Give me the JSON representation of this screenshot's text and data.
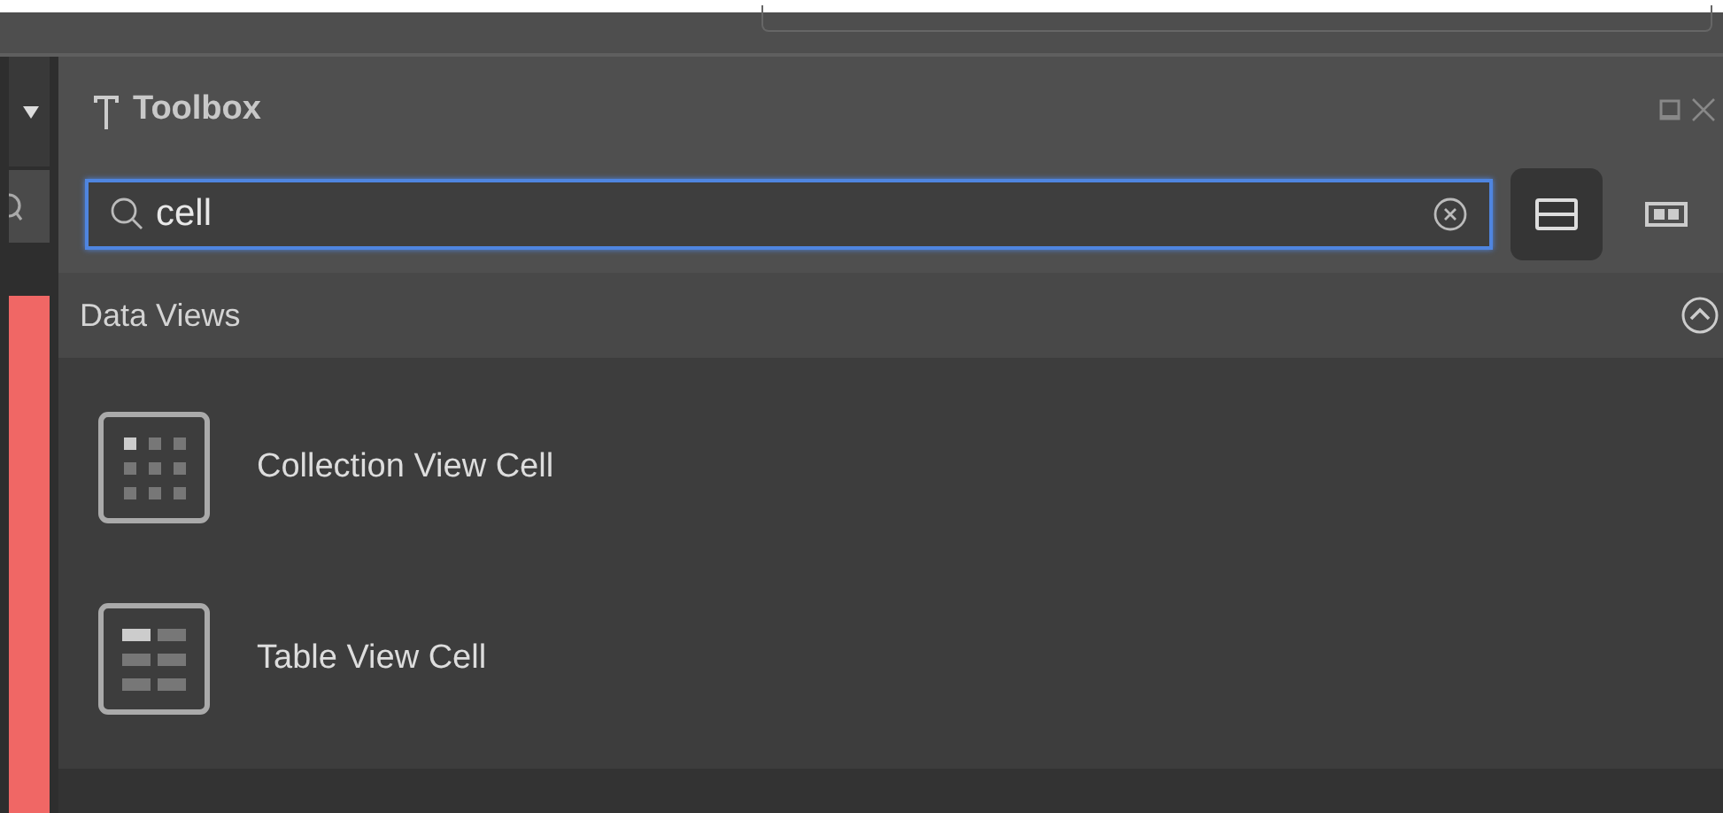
{
  "panel": {
    "title": "Toolbox"
  },
  "search": {
    "value": "cell"
  },
  "view_modes": [
    {
      "kind": "list",
      "selected": true
    },
    {
      "kind": "grid",
      "selected": false
    }
  ],
  "section": {
    "title": "Data Views",
    "expanded": true
  },
  "items": [
    {
      "kind": "collection",
      "label": "Collection View Cell"
    },
    {
      "kind": "table",
      "label": "Table View Cell"
    }
  ]
}
